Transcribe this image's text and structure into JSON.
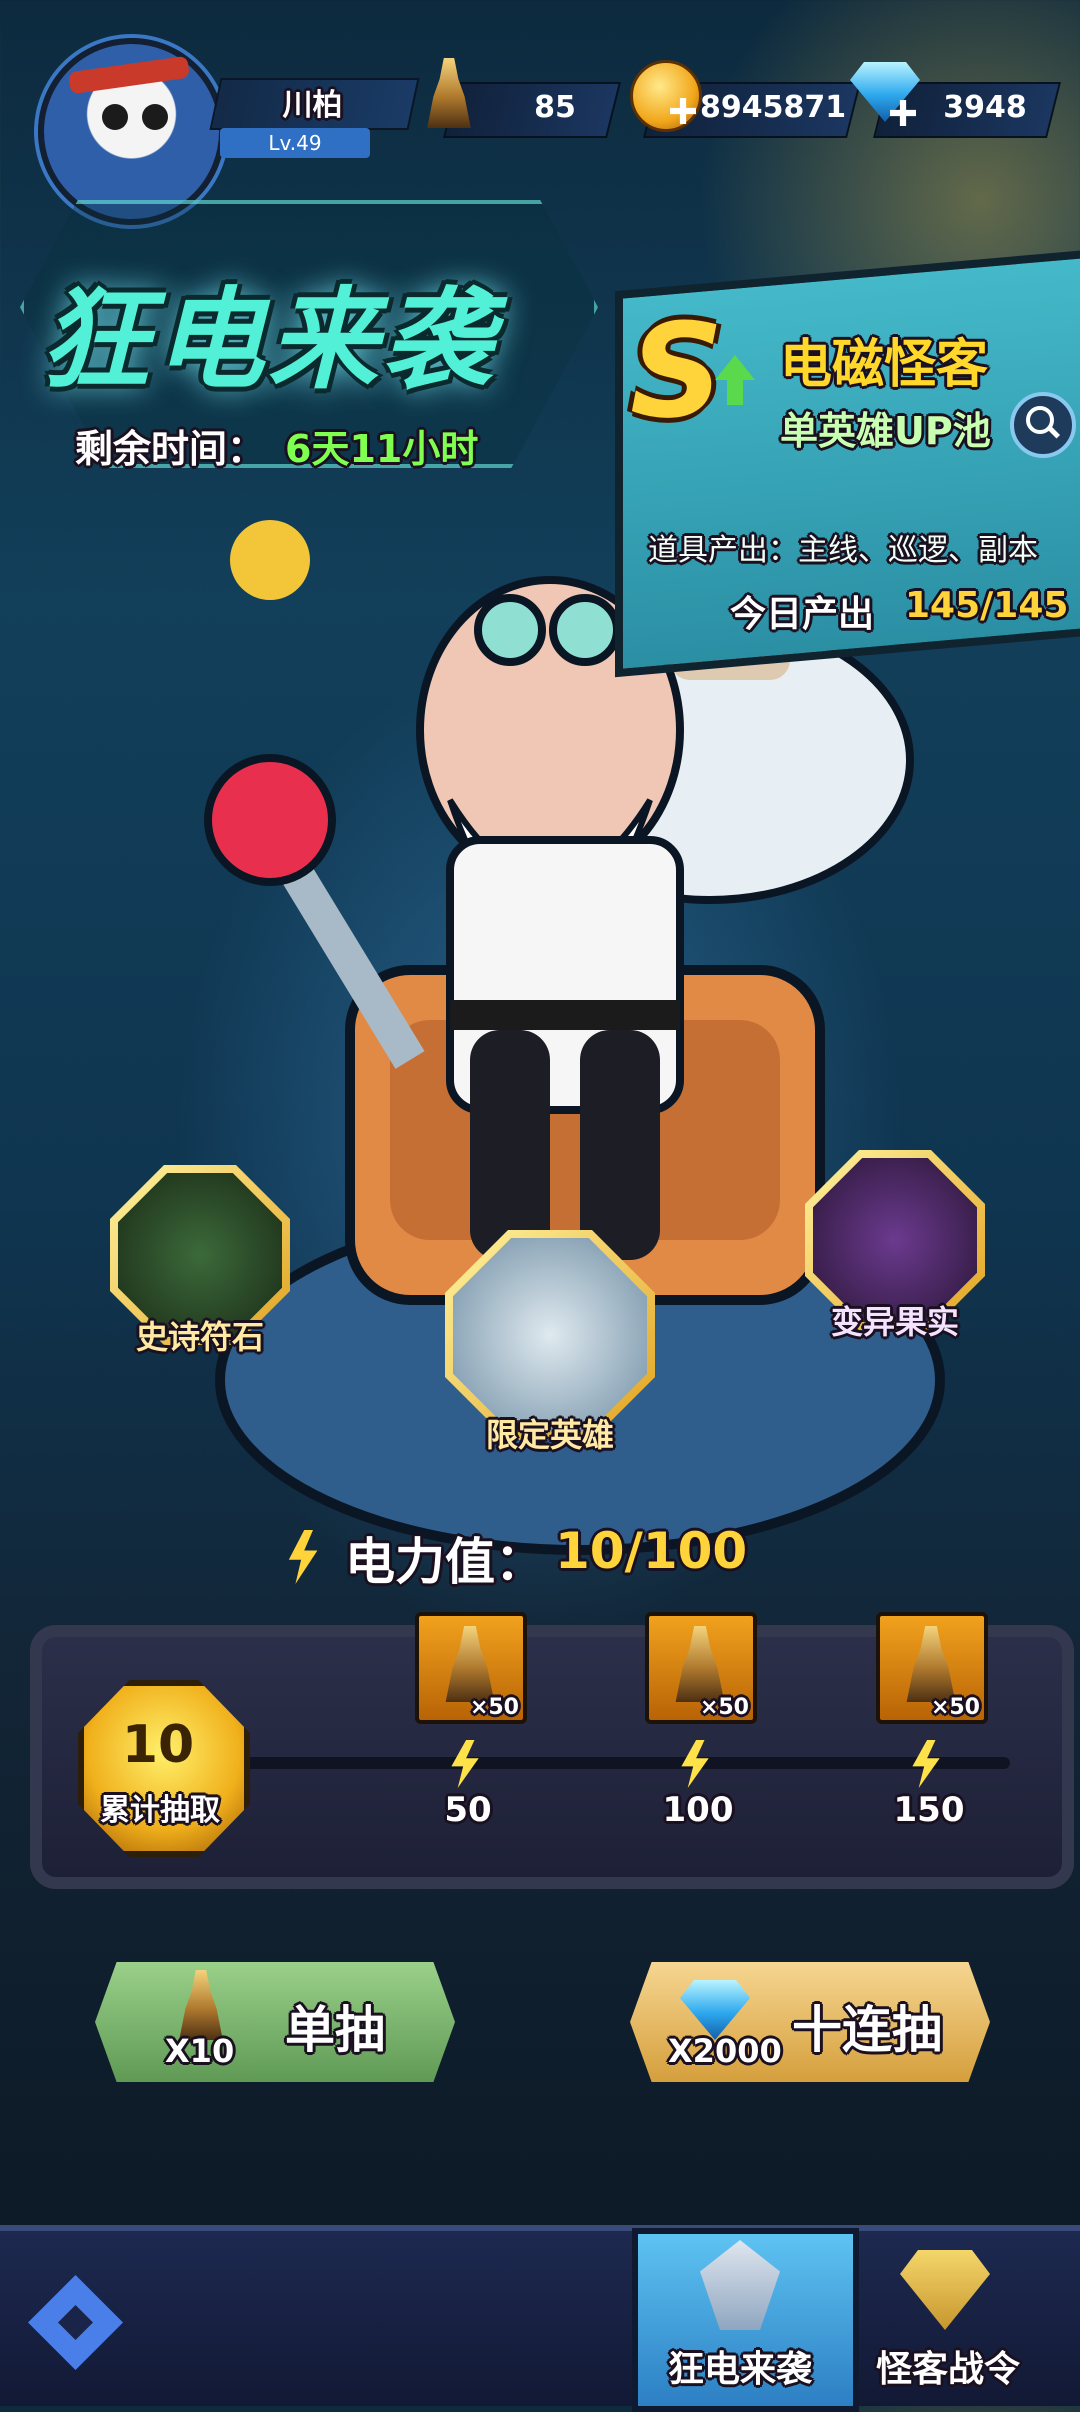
{
  "player": {
    "name": "川柏",
    "level": "Lv.49"
  },
  "resources": {
    "tower_count": "85",
    "gold": "8945871",
    "diamonds": "3948"
  },
  "event": {
    "title": "狂电来袭",
    "remaining_label": "剩余时间：",
    "remaining_value": "6天11小时"
  },
  "pool": {
    "rank": "S",
    "hero_name": "电磁怪客",
    "pool_type": "单英雄UP池",
    "items_output": "道具产出：主线、巡逻、副本",
    "today_label": "今日产出",
    "today_value": "145/145"
  },
  "rewards": {
    "left": "史诗符石",
    "center": "限定英雄",
    "right": "变异果实"
  },
  "power": {
    "label": "电力值：",
    "value": "10/100",
    "fraction": 0.1
  },
  "cumulative": {
    "count": "10",
    "label": "累计抽取",
    "progress_fraction": 0.07,
    "milestones": [
      {
        "qty": "×50",
        "value": "50"
      },
      {
        "qty": "×50",
        "value": "100"
      },
      {
        "qty": "×50",
        "value": "150"
      }
    ]
  },
  "buttons": {
    "single": {
      "label": "单抽",
      "cost": "X10"
    },
    "ten": {
      "label": "十连抽",
      "cost": "X2000"
    }
  },
  "nav": {
    "tab_event": "狂电来袭",
    "tab_pass": "怪客战令"
  },
  "colors": {
    "accent_gold": "#ffd43a",
    "accent_green": "#7fff4f",
    "title_cyan": "#52f0d7"
  }
}
